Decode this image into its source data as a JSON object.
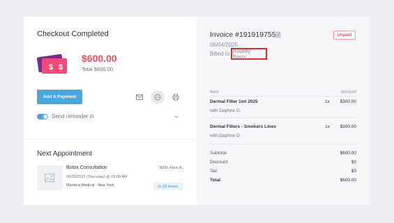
{
  "checkout": {
    "title": "Checkout Completed",
    "amount": "$600.00",
    "total": "Total $600.00",
    "pay_button": "Add A Payment",
    "reminder": "Send reminder in"
  },
  "appointment": {
    "section_title": "Next Appointment",
    "name": "Botox Consultation",
    "with": "With Alex A.",
    "datetime": "06/05/2025 (Thursday) @ 09:00 AM",
    "location": "Maniera Medical - New York",
    "badge": "In 18 Hours"
  },
  "invoice": {
    "title": "Invoice #191919755",
    "status": "Unpaid",
    "date": "06/04/2025",
    "billed_prefix": "Billed to",
    "billed_name": "Audrey Berry",
    "columns": {
      "item": "Item",
      "amount": "Amount"
    },
    "items": [
      {
        "name": "Dermal Filler 1ml 2025",
        "with": "with Daphne D.",
        "qty": "1x",
        "amount": "$300.00"
      },
      {
        "name": "Dermal Fillers - Smokers Lines",
        "with": "with Daphne D.",
        "qty": "1x",
        "amount": "$300.00"
      }
    ],
    "summary": {
      "subtotal_label": "Subtotal",
      "subtotal": "$600.00",
      "discount_label": "Discount",
      "discount": "$0",
      "tax_label": "Tax",
      "tax": "$0",
      "total_label": "Total",
      "total": "$600.00"
    }
  },
  "icons": [
    "money-icon",
    "mail-icon",
    "chat-icon",
    "print-icon",
    "chevron-down-icon",
    "image-placeholder-icon",
    "file-icon"
  ],
  "colors": {
    "accent": "#4aa8e0",
    "amount": "#ef4a5f",
    "unpaid": "#e54b5e",
    "highlight": "#e02a2a"
  }
}
